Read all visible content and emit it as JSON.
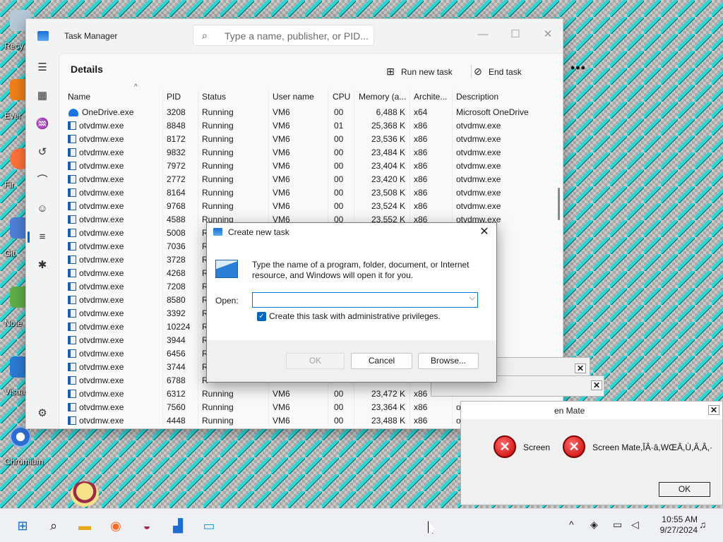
{
  "desktop": {
    "labels": [
      "Recy",
      "Ever",
      "Fir",
      "Git",
      "Note",
      "Visua",
      "Chromium"
    ]
  },
  "task_manager": {
    "title": "Task Manager",
    "search_placeholder": "Type a name, publisher, or PID...",
    "heading": "Details",
    "run_new_task": "Run new task",
    "end_task": "End task",
    "more": "•••",
    "columns": [
      "Name",
      "PID",
      "Status",
      "User name",
      "CPU",
      "Memory (a...",
      "Archite...",
      "Description"
    ],
    "rows": [
      {
        "name": "OneDrive.exe",
        "pid": "3208",
        "status": "Running",
        "user": "VM6",
        "cpu": "00",
        "mem": "6,488 K",
        "arch": "x64",
        "desc": "Microsoft OneDrive"
      },
      {
        "name": "otvdmw.exe",
        "pid": "8848",
        "status": "Running",
        "user": "VM6",
        "cpu": "01",
        "mem": "25,368 K",
        "arch": "x86",
        "desc": "otvdmw.exe"
      },
      {
        "name": "otvdmw.exe",
        "pid": "8172",
        "status": "Running",
        "user": "VM6",
        "cpu": "00",
        "mem": "23,536 K",
        "arch": "x86",
        "desc": "otvdmw.exe"
      },
      {
        "name": "otvdmw.exe",
        "pid": "9832",
        "status": "Running",
        "user": "VM6",
        "cpu": "00",
        "mem": "23,484 K",
        "arch": "x86",
        "desc": "otvdmw.exe"
      },
      {
        "name": "otvdmw.exe",
        "pid": "7972",
        "status": "Running",
        "user": "VM6",
        "cpu": "00",
        "mem": "23,404 K",
        "arch": "x86",
        "desc": "otvdmw.exe"
      },
      {
        "name": "otvdmw.exe",
        "pid": "2772",
        "status": "Running",
        "user": "VM6",
        "cpu": "00",
        "mem": "23,420 K",
        "arch": "x86",
        "desc": "otvdmw.exe"
      },
      {
        "name": "otvdmw.exe",
        "pid": "8164",
        "status": "Running",
        "user": "VM6",
        "cpu": "00",
        "mem": "23,508 K",
        "arch": "x86",
        "desc": "otvdmw.exe"
      },
      {
        "name": "otvdmw.exe",
        "pid": "9768",
        "status": "Running",
        "user": "VM6",
        "cpu": "00",
        "mem": "23,524 K",
        "arch": "x86",
        "desc": "otvdmw.exe"
      },
      {
        "name": "otvdmw.exe",
        "pid": "4588",
        "status": "Running",
        "user": "VM6",
        "cpu": "00",
        "mem": "23,552 K",
        "arch": "x86",
        "desc": "otvdmw.exe"
      },
      {
        "name": "otvdmw.exe",
        "pid": "5008",
        "status": "R",
        "user": "",
        "cpu": "",
        "mem": "",
        "arch": "",
        "desc": ""
      },
      {
        "name": "otvdmw.exe",
        "pid": "7036",
        "status": "R",
        "user": "",
        "cpu": "",
        "mem": "",
        "arch": "",
        "desc": ""
      },
      {
        "name": "otvdmw.exe",
        "pid": "3728",
        "status": "R",
        "user": "",
        "cpu": "",
        "mem": "",
        "arch": "",
        "desc": ""
      },
      {
        "name": "otvdmw.exe",
        "pid": "4268",
        "status": "R",
        "user": "",
        "cpu": "",
        "mem": "",
        "arch": "",
        "desc": ""
      },
      {
        "name": "otvdmw.exe",
        "pid": "7208",
        "status": "R",
        "user": "",
        "cpu": "",
        "mem": "",
        "arch": "",
        "desc": ""
      },
      {
        "name": "otvdmw.exe",
        "pid": "8580",
        "status": "R",
        "user": "",
        "cpu": "",
        "mem": "",
        "arch": "",
        "desc": ""
      },
      {
        "name": "otvdmw.exe",
        "pid": "3392",
        "status": "R",
        "user": "",
        "cpu": "",
        "mem": "",
        "arch": "",
        "desc": ""
      },
      {
        "name": "otvdmw.exe",
        "pid": "10224",
        "status": "R",
        "user": "",
        "cpu": "",
        "mem": "",
        "arch": "",
        "desc": ""
      },
      {
        "name": "otvdmw.exe",
        "pid": "3944",
        "status": "R",
        "user": "",
        "cpu": "",
        "mem": "",
        "arch": "",
        "desc": ""
      },
      {
        "name": "otvdmw.exe",
        "pid": "6456",
        "status": "R",
        "user": "",
        "cpu": "",
        "mem": "",
        "arch": "",
        "desc": ""
      },
      {
        "name": "otvdmw.exe",
        "pid": "3744",
        "status": "R",
        "user": "",
        "cpu": "",
        "mem": "",
        "arch": "",
        "desc": ""
      },
      {
        "name": "otvdmw.exe",
        "pid": "6788",
        "status": "R",
        "user": "",
        "cpu": "",
        "mem": "",
        "arch": "",
        "desc": ""
      },
      {
        "name": "otvdmw.exe",
        "pid": "6312",
        "status": "Running",
        "user": "VM6",
        "cpu": "00",
        "mem": "23,472 K",
        "arch": "x86",
        "desc": "otvdmw.exe"
      },
      {
        "name": "otvdmw.exe",
        "pid": "7560",
        "status": "Running",
        "user": "VM6",
        "cpu": "00",
        "mem": "23,364 K",
        "arch": "x86",
        "desc": "otvdmw.exe"
      },
      {
        "name": "otvdmw.exe",
        "pid": "4448",
        "status": "Running",
        "user": "VM6",
        "cpu": "00",
        "mem": "23,488 K",
        "arch": "x86",
        "desc": "otvdmw.exe"
      }
    ]
  },
  "dialog": {
    "title": "Create new task",
    "message": "Type the name of a program, folder, document, or Internet resource, and Windows will open it for you.",
    "open_label": "Open:",
    "open_value": "",
    "admin_label": "Create this task with administrative privileges.",
    "admin_checked": true,
    "ok": "OK",
    "cancel": "Cancel",
    "browse": "Browse..."
  },
  "screen_mate": {
    "title": "en Mate",
    "text_left": "Screen",
    "text_right": "Screen Mate,ÎÂ·â,WŒÂ,Ù,Â,Â,·",
    "ok": "OK"
  },
  "taskbar": {
    "time": "10:55 AM",
    "date": "9/27/2024"
  },
  "colors": {
    "accent": "#0067c0",
    "desktop_teal": "#2fd6d6",
    "error_red": "#c40000"
  }
}
